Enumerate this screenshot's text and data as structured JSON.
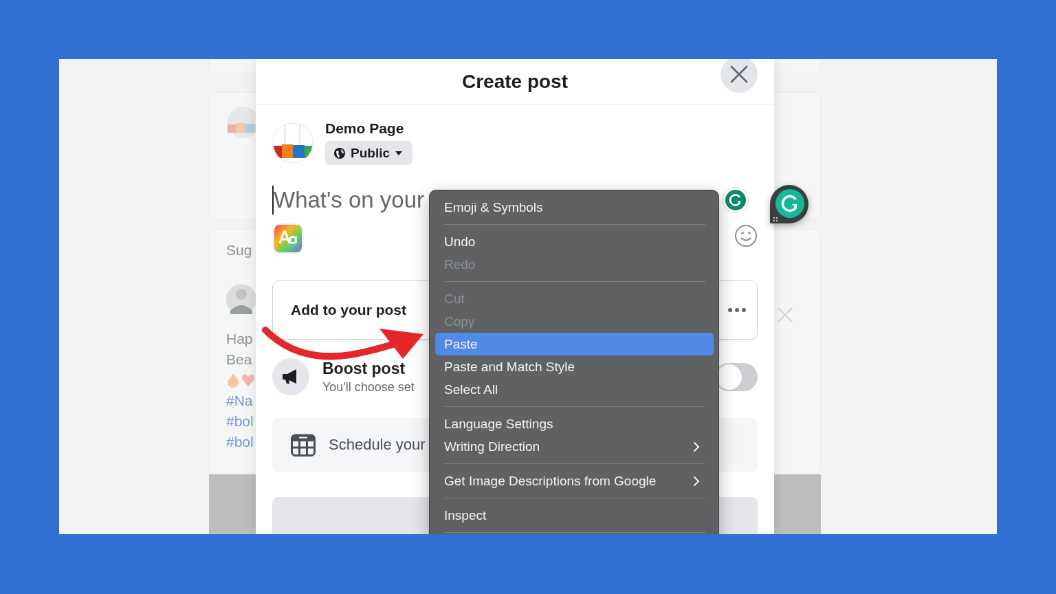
{
  "background_feed": {
    "section_label": "Sug",
    "post_lines": [
      {
        "kind": "text",
        "text": "Hap"
      },
      {
        "kind": "text",
        "text": "Bea"
      },
      {
        "kind": "emoji"
      },
      {
        "kind": "hashtag",
        "text": "#Na"
      },
      {
        "kind": "hashtag",
        "text": "#bol"
      },
      {
        "kind": "hashtag",
        "text": "#bol"
      }
    ]
  },
  "dialog": {
    "title": "Create post",
    "author": {
      "name": "Demo Page",
      "audience": "Public"
    },
    "composer": {
      "placeholder": "What's on your"
    },
    "add_to_post": {
      "label": "Add to your post"
    },
    "boost": {
      "title": "Boost post",
      "subtitle": "You'll choose set",
      "on": false
    },
    "schedule": {
      "label": "Schedule your"
    }
  },
  "context_menu": [
    {
      "kind": "item",
      "label": "Emoji & Symbols",
      "disabled": false,
      "selected": false,
      "submenu": false
    },
    {
      "kind": "separator"
    },
    {
      "kind": "item",
      "label": "Undo",
      "disabled": false,
      "selected": false,
      "submenu": false
    },
    {
      "kind": "item",
      "label": "Redo",
      "disabled": true,
      "selected": false,
      "submenu": false
    },
    {
      "kind": "separator"
    },
    {
      "kind": "item",
      "label": "Cut",
      "disabled": true,
      "selected": false,
      "submenu": false
    },
    {
      "kind": "item",
      "label": "Copy",
      "disabled": true,
      "selected": false,
      "submenu": false
    },
    {
      "kind": "item",
      "label": "Paste",
      "disabled": false,
      "selected": true,
      "submenu": false
    },
    {
      "kind": "item",
      "label": "Paste and Match Style",
      "disabled": false,
      "selected": false,
      "submenu": false
    },
    {
      "kind": "item",
      "label": "Select All",
      "disabled": false,
      "selected": false,
      "submenu": false
    },
    {
      "kind": "separator"
    },
    {
      "kind": "item",
      "label": "Language Settings",
      "disabled": false,
      "selected": false,
      "submenu": false
    },
    {
      "kind": "item",
      "label": "Writing Direction",
      "disabled": false,
      "selected": false,
      "submenu": true
    },
    {
      "kind": "separator"
    },
    {
      "kind": "item",
      "label": "Get Image Descriptions from Google",
      "disabled": false,
      "selected": false,
      "submenu": true
    },
    {
      "kind": "separator"
    },
    {
      "kind": "item",
      "label": "Inspect",
      "disabled": false,
      "selected": false,
      "submenu": false
    },
    {
      "kind": "separator"
    }
  ]
}
